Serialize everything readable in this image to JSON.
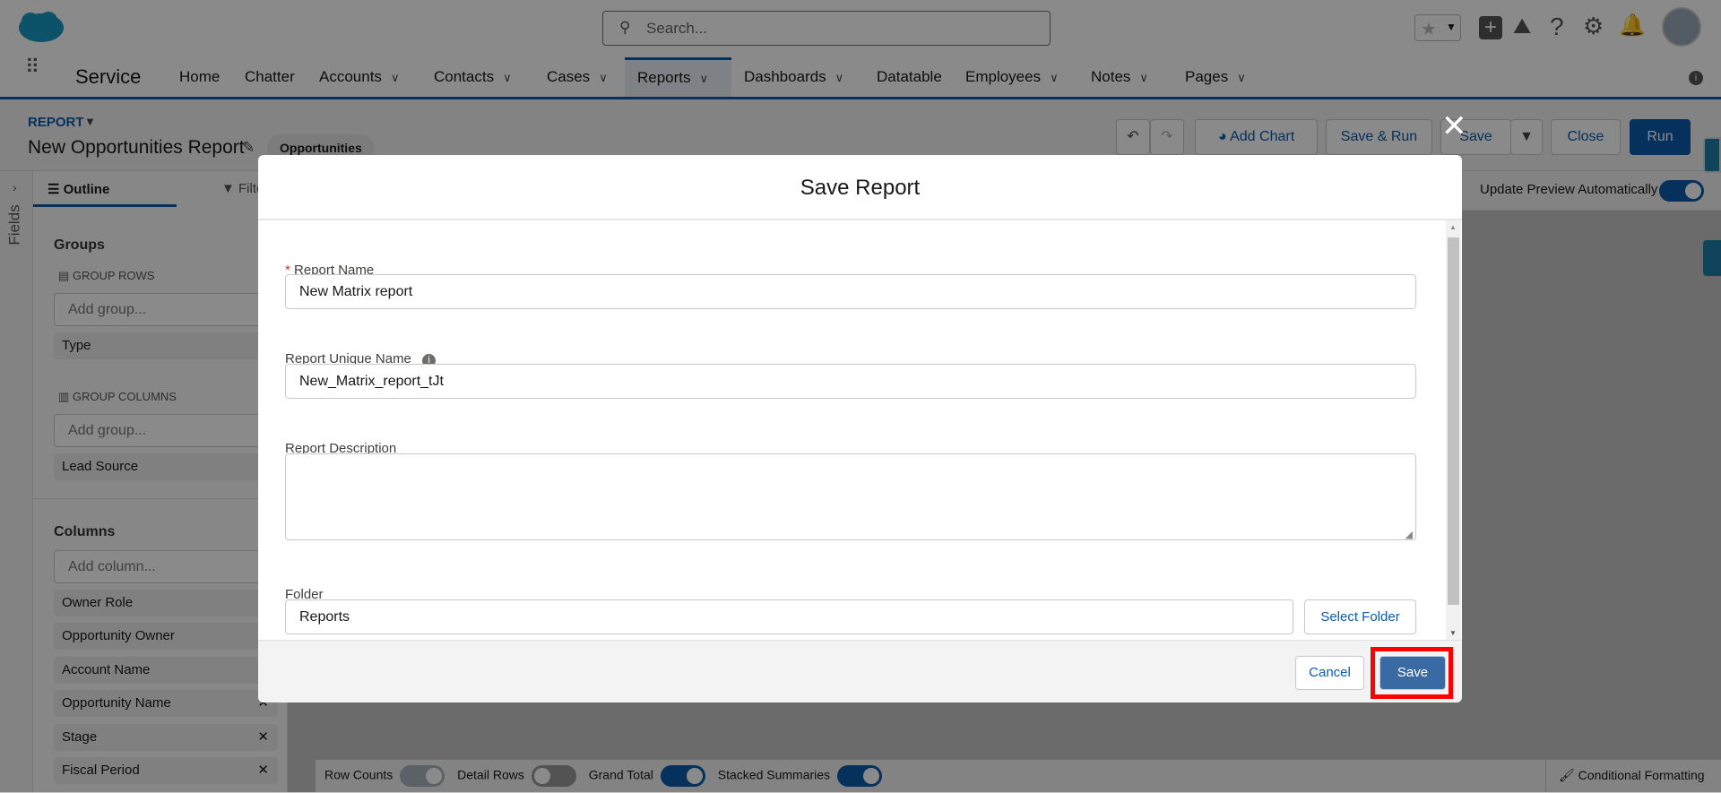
{
  "app": {
    "name": "Service",
    "search_placeholder": "Search..."
  },
  "nav": [
    {
      "label": "Home",
      "menu": false
    },
    {
      "label": "Chatter",
      "menu": false
    },
    {
      "label": "Accounts",
      "menu": true
    },
    {
      "label": "Contacts",
      "menu": true
    },
    {
      "label": "Cases",
      "menu": true
    },
    {
      "label": "Reports",
      "menu": true,
      "active": true
    },
    {
      "label": "Dashboards",
      "menu": true
    },
    {
      "label": "Datatable",
      "menu": false
    },
    {
      "label": "Employees",
      "menu": true
    },
    {
      "label": "Notes",
      "menu": true
    },
    {
      "label": "Pages",
      "menu": true
    }
  ],
  "report": {
    "type_label": "REPORT",
    "title": "New Opportunities Report",
    "report_type": "Opportunities"
  },
  "toolbar": {
    "add_chart": "Add Chart",
    "save_run": "Save & Run",
    "save": "Save",
    "close": "Close",
    "run": "Run"
  },
  "preview": {
    "update_label": "Update Preview Automatically",
    "update_on": true
  },
  "sidebar": {
    "fields_label": "Fields",
    "tab_outline": "Outline",
    "tab_filters": "Filters",
    "groups_title": "Groups",
    "group_rows_label": "GROUP ROWS",
    "add_group_placeholder": "Add group...",
    "group_rows": [
      "Type"
    ],
    "group_columns_label": "GROUP COLUMNS",
    "group_columns": [
      "Lead Source"
    ],
    "columns_title": "Columns",
    "add_column_placeholder": "Add column...",
    "columns": [
      "Owner Role",
      "Opportunity Owner",
      "Account Name",
      "Opportunity Name",
      "Stage",
      "Fiscal Period"
    ]
  },
  "bottom": {
    "row_counts": "Row Counts",
    "detail_rows": "Detail Rows",
    "grand_total": "Grand Total",
    "stacked_summaries": "Stacked Summaries",
    "conditional_formatting": "Conditional Formatting"
  },
  "modal": {
    "title": "Save Report",
    "report_name_label": "Report Name",
    "report_name": "New Matrix report",
    "unique_name_label": "Report Unique Name",
    "unique_name": "New_Matrix_report_tJt",
    "description_label": "Report Description",
    "description": "",
    "folder_label": "Folder",
    "folder": "Reports",
    "select_folder": "Select Folder",
    "cancel": "Cancel",
    "save": "Save"
  },
  "colors": {
    "brand": "#0b5cab",
    "highlight": "#ff0000",
    "save_button": "#3a6aa3"
  }
}
